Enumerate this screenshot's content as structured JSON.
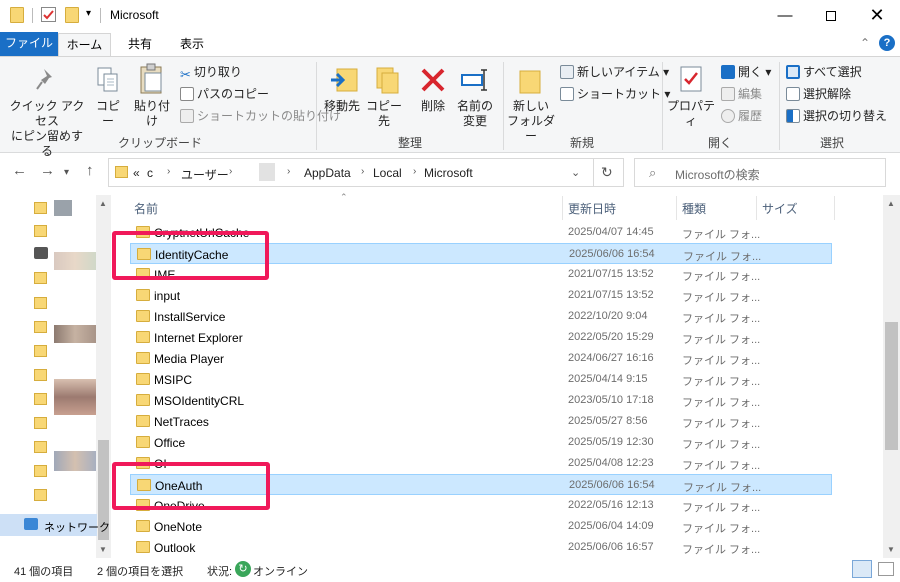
{
  "window": {
    "title": "Microsoft"
  },
  "ribbon_tabs": {
    "file": "ファイル",
    "home": "ホーム",
    "share": "共有",
    "view": "表示"
  },
  "ribbon": {
    "clipboard": {
      "label": "クリップボード",
      "pin": "クイック アクセス\nにピン留めする",
      "copy": "コピー",
      "paste": "貼り付け",
      "cut": "切り取り",
      "copy_path": "パスのコピー",
      "paste_shortcut": "ショートカットの貼り付け"
    },
    "organize": {
      "label": "整理",
      "move_to": "移動先",
      "copy_to": "コピー先",
      "delete": "削除",
      "rename": "名前の\n変更"
    },
    "new": {
      "label": "新規",
      "new_folder": "新しい\nフォルダー",
      "new_item": "新しいアイテム",
      "shortcut": "ショートカット"
    },
    "open": {
      "label": "開く",
      "properties": "プロパティ",
      "open": "開く",
      "edit": "編集",
      "history": "履歴"
    },
    "select": {
      "label": "選択",
      "select_all": "すべて選択",
      "select_none": "選択解除",
      "invert": "選択の切り替え"
    }
  },
  "address": {
    "overflow": "«",
    "part1": "c",
    "users": "ユーザー",
    "appdata": "AppData",
    "local": "Local",
    "microsoft": "Microsoft"
  },
  "search": {
    "placeholder": "Microsoftの検索"
  },
  "columns": {
    "name": "名前",
    "date": "更新日時",
    "type": "種類",
    "size": "サイズ"
  },
  "nav": {
    "network": "ネットワーク"
  },
  "files": [
    {
      "name": "CryptnetUrlCache",
      "date": "2025/04/07 14:45",
      "type": "ファイル フォ...",
      "selected": false
    },
    {
      "name": "IdentityCache",
      "date": "2025/06/06 16:54",
      "type": "ファイル フォ...",
      "selected": true
    },
    {
      "name": "IME",
      "date": "2021/07/15 13:52",
      "type": "ファイル フォ...",
      "selected": false
    },
    {
      "name": "input",
      "date": "2021/07/15 13:52",
      "type": "ファイル フォ...",
      "selected": false
    },
    {
      "name": "InstallService",
      "date": "2022/10/20 9:04",
      "type": "ファイル フォ...",
      "selected": false
    },
    {
      "name": "Internet Explorer",
      "date": "2022/05/20 15:29",
      "type": "ファイル フォ...",
      "selected": false
    },
    {
      "name": "Media Player",
      "date": "2024/06/27 16:16",
      "type": "ファイル フォ...",
      "selected": false
    },
    {
      "name": "MSIPC",
      "date": "2025/04/14 9:15",
      "type": "ファイル フォ...",
      "selected": false
    },
    {
      "name": "MSOIdentityCRL",
      "date": "2023/05/10 17:18",
      "type": "ファイル フォ...",
      "selected": false
    },
    {
      "name": "NetTraces",
      "date": "2025/05/27 8:56",
      "type": "ファイル フォ...",
      "selected": false
    },
    {
      "name": "Office",
      "date": "2025/05/19 12:30",
      "type": "ファイル フォ...",
      "selected": false
    },
    {
      "name": "OI",
      "date": "2025/04/08 12:23",
      "type": "ファイル フォ...",
      "selected": false
    },
    {
      "name": "OneAuth",
      "date": "2025/06/06 16:54",
      "type": "ファイル フォ...",
      "selected": true
    },
    {
      "name": "OneDrive",
      "date": "2022/05/16 12:13",
      "type": "ファイル フォ...",
      "selected": false
    },
    {
      "name": "OneNote",
      "date": "2025/06/04 14:09",
      "type": "ファイル フォ...",
      "selected": false
    },
    {
      "name": "Outlook",
      "date": "2025/06/06 16:57",
      "type": "ファイル フォ...",
      "selected": false
    }
  ],
  "status": {
    "count": "41 個の項目",
    "selected": "2 個の項目を選択",
    "state_label": "状況:",
    "state_value": "オンライン"
  },
  "colors": {
    "accent": "#1a6fc6",
    "selection": "#cce8ff",
    "highlight": "#f0195a",
    "folder": "#f8d775"
  }
}
